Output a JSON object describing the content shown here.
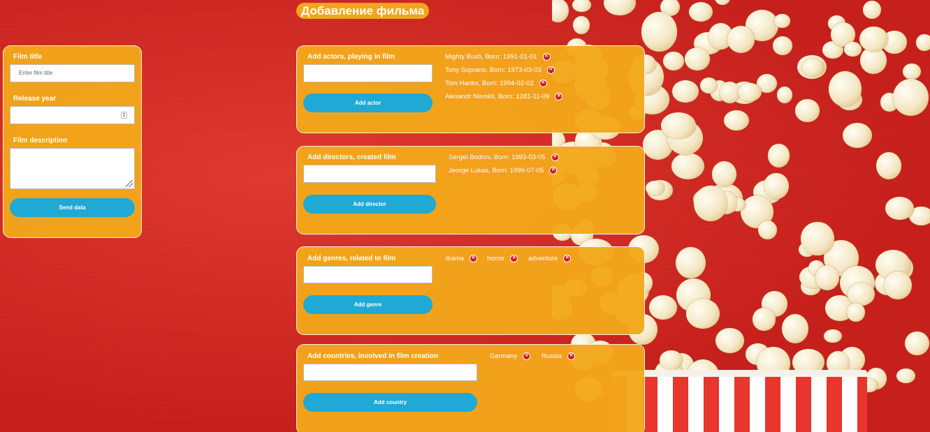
{
  "page_title": "Добавление фильма",
  "film_form": {
    "title_label": "Film title",
    "title_placeholder": "Enter film title",
    "year_label": "Release year",
    "description_label": "Film description",
    "send_button": "Send data"
  },
  "actors": {
    "label": "Add actors, playing in film",
    "button": "Add actor",
    "items": [
      "Mighty Bush, Born: 1991-01-01",
      "Tony Soprano, Born: 1973-03-03",
      "Tom Hanks, Born: 1994-02-02",
      "Alexandr Nevskii, Born: 1281-11-09"
    ]
  },
  "directors": {
    "label": "Add directors, created film",
    "button": "Add director",
    "items": [
      "Sergei Bodrov, Born: 1993-03-05",
      "Jeorge Lukas, Born: 1999-07-05"
    ]
  },
  "genres": {
    "label": "Add genres, related to film",
    "button": "Add genre",
    "items": [
      "drama",
      "horror",
      "adventure"
    ]
  },
  "countries": {
    "label": "Add countries, involved in film creation",
    "button": "Add country",
    "items": [
      "Germany",
      "Russia"
    ]
  },
  "remove_icon_glyph": "✕",
  "colors": {
    "background": "#d62a25",
    "panel": "#f3a81a",
    "button": "#1fa9d4",
    "remove": "#d8141d"
  }
}
